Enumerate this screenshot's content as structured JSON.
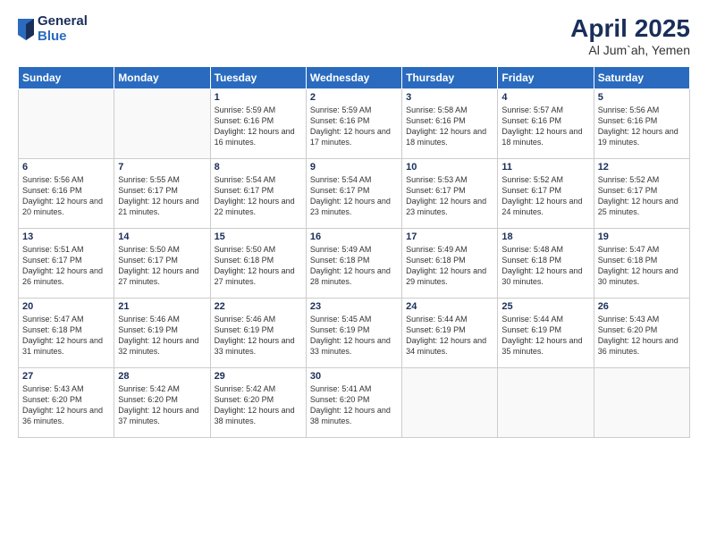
{
  "logo": {
    "general": "General",
    "blue": "Blue"
  },
  "header": {
    "title": "April 2025",
    "subtitle": "Al Jum`ah, Yemen"
  },
  "days_of_week": [
    "Sunday",
    "Monday",
    "Tuesday",
    "Wednesday",
    "Thursday",
    "Friday",
    "Saturday"
  ],
  "weeks": [
    [
      {
        "day": "",
        "info": ""
      },
      {
        "day": "",
        "info": ""
      },
      {
        "day": "1",
        "info": "Sunrise: 5:59 AM\nSunset: 6:16 PM\nDaylight: 12 hours and 16 minutes."
      },
      {
        "day": "2",
        "info": "Sunrise: 5:59 AM\nSunset: 6:16 PM\nDaylight: 12 hours and 17 minutes."
      },
      {
        "day": "3",
        "info": "Sunrise: 5:58 AM\nSunset: 6:16 PM\nDaylight: 12 hours and 18 minutes."
      },
      {
        "day": "4",
        "info": "Sunrise: 5:57 AM\nSunset: 6:16 PM\nDaylight: 12 hours and 18 minutes."
      },
      {
        "day": "5",
        "info": "Sunrise: 5:56 AM\nSunset: 6:16 PM\nDaylight: 12 hours and 19 minutes."
      }
    ],
    [
      {
        "day": "6",
        "info": "Sunrise: 5:56 AM\nSunset: 6:16 PM\nDaylight: 12 hours and 20 minutes."
      },
      {
        "day": "7",
        "info": "Sunrise: 5:55 AM\nSunset: 6:17 PM\nDaylight: 12 hours and 21 minutes."
      },
      {
        "day": "8",
        "info": "Sunrise: 5:54 AM\nSunset: 6:17 PM\nDaylight: 12 hours and 22 minutes."
      },
      {
        "day": "9",
        "info": "Sunrise: 5:54 AM\nSunset: 6:17 PM\nDaylight: 12 hours and 23 minutes."
      },
      {
        "day": "10",
        "info": "Sunrise: 5:53 AM\nSunset: 6:17 PM\nDaylight: 12 hours and 23 minutes."
      },
      {
        "day": "11",
        "info": "Sunrise: 5:52 AM\nSunset: 6:17 PM\nDaylight: 12 hours and 24 minutes."
      },
      {
        "day": "12",
        "info": "Sunrise: 5:52 AM\nSunset: 6:17 PM\nDaylight: 12 hours and 25 minutes."
      }
    ],
    [
      {
        "day": "13",
        "info": "Sunrise: 5:51 AM\nSunset: 6:17 PM\nDaylight: 12 hours and 26 minutes."
      },
      {
        "day": "14",
        "info": "Sunrise: 5:50 AM\nSunset: 6:17 PM\nDaylight: 12 hours and 27 minutes."
      },
      {
        "day": "15",
        "info": "Sunrise: 5:50 AM\nSunset: 6:18 PM\nDaylight: 12 hours and 27 minutes."
      },
      {
        "day": "16",
        "info": "Sunrise: 5:49 AM\nSunset: 6:18 PM\nDaylight: 12 hours and 28 minutes."
      },
      {
        "day": "17",
        "info": "Sunrise: 5:49 AM\nSunset: 6:18 PM\nDaylight: 12 hours and 29 minutes."
      },
      {
        "day": "18",
        "info": "Sunrise: 5:48 AM\nSunset: 6:18 PM\nDaylight: 12 hours and 30 minutes."
      },
      {
        "day": "19",
        "info": "Sunrise: 5:47 AM\nSunset: 6:18 PM\nDaylight: 12 hours and 30 minutes."
      }
    ],
    [
      {
        "day": "20",
        "info": "Sunrise: 5:47 AM\nSunset: 6:18 PM\nDaylight: 12 hours and 31 minutes."
      },
      {
        "day": "21",
        "info": "Sunrise: 5:46 AM\nSunset: 6:19 PM\nDaylight: 12 hours and 32 minutes."
      },
      {
        "day": "22",
        "info": "Sunrise: 5:46 AM\nSunset: 6:19 PM\nDaylight: 12 hours and 33 minutes."
      },
      {
        "day": "23",
        "info": "Sunrise: 5:45 AM\nSunset: 6:19 PM\nDaylight: 12 hours and 33 minutes."
      },
      {
        "day": "24",
        "info": "Sunrise: 5:44 AM\nSunset: 6:19 PM\nDaylight: 12 hours and 34 minutes."
      },
      {
        "day": "25",
        "info": "Sunrise: 5:44 AM\nSunset: 6:19 PM\nDaylight: 12 hours and 35 minutes."
      },
      {
        "day": "26",
        "info": "Sunrise: 5:43 AM\nSunset: 6:20 PM\nDaylight: 12 hours and 36 minutes."
      }
    ],
    [
      {
        "day": "27",
        "info": "Sunrise: 5:43 AM\nSunset: 6:20 PM\nDaylight: 12 hours and 36 minutes."
      },
      {
        "day": "28",
        "info": "Sunrise: 5:42 AM\nSunset: 6:20 PM\nDaylight: 12 hours and 37 minutes."
      },
      {
        "day": "29",
        "info": "Sunrise: 5:42 AM\nSunset: 6:20 PM\nDaylight: 12 hours and 38 minutes."
      },
      {
        "day": "30",
        "info": "Sunrise: 5:41 AM\nSunset: 6:20 PM\nDaylight: 12 hours and 38 minutes."
      },
      {
        "day": "",
        "info": ""
      },
      {
        "day": "",
        "info": ""
      },
      {
        "day": "",
        "info": ""
      }
    ]
  ]
}
